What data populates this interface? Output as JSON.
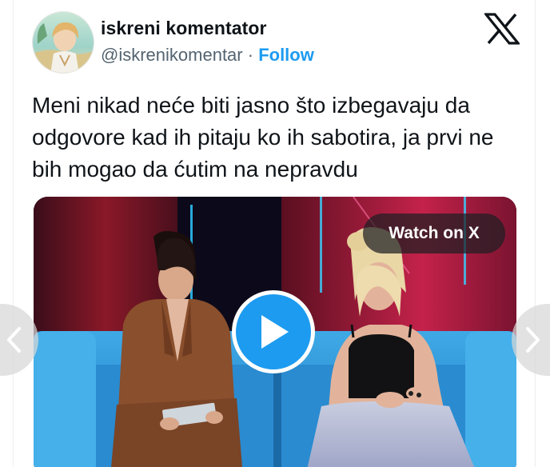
{
  "tweet": {
    "author_name": "iskreni komentator",
    "author_handle": "@iskrenikomentar",
    "separator": " · ",
    "follow_label": "Follow",
    "text": "Meni nikad neće biti jasno što izbegavaju da odgovore kad ih pitaju ko ih sabotira, ja prvi ne bih mogao da ćutim na nepravdu"
  },
  "media": {
    "watch_label": "Watch on X",
    "play_icon": "play-icon",
    "type": "video"
  },
  "icons": {
    "brand": "x-logo-icon",
    "prev": "chevron-left-icon",
    "next": "chevron-right-icon"
  },
  "colors": {
    "accent": "#1d9bf0",
    "text": "#0f1419",
    "muted": "#536471"
  }
}
